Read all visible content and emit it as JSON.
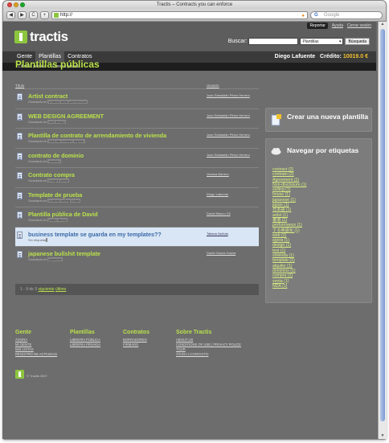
{
  "window": {
    "title": "Tractis – Contracts you can enforce"
  },
  "browser": {
    "url": "http://",
    "search_placeholder": "Google",
    "buttons": {
      "back": "◀",
      "forward": "▶",
      "reload": "C",
      "add": "+"
    }
  },
  "brand": {
    "name": "tractis",
    "accent": "#b9e14a",
    "logo_green": "#8cc63f"
  },
  "top_links": {
    "report": "Reportar",
    "help": "Ayuda",
    "logout": "Cerrar sesión"
  },
  "search": {
    "label": "Buscar:",
    "value": "",
    "scope": "Plantillas",
    "button": "Búsqueda"
  },
  "nav": {
    "tabs": [
      {
        "label": "Gente"
      },
      {
        "label": "Plantillas"
      },
      {
        "label": "Contratos"
      }
    ],
    "user": "Diego Lafuente",
    "credit_label": "Crédito:",
    "credit_value": "10019.0 €"
  },
  "subnav": {
    "items": [
      "Librería pública",
      "Librería privada"
    ]
  },
  "page_title": "Plantillas públicas",
  "table": {
    "headers": {
      "title": "Título",
      "user": "Usuario"
    },
    "rows": [
      {
        "title": "Artist contract",
        "meta_prefix": "Guardado en",
        "tags": "contract artist performance",
        "author": "Juan Sebastián Pérez Herrero"
      },
      {
        "title": "WEB DESIGN AGREEMENT",
        "meta_prefix": "Guardado en",
        "tags": "web design",
        "author": "Juan Sebastián Pérez Herrero"
      },
      {
        "title": "Plantilla de contrato de arrendamiento de vivienda",
        "meta_prefix": "Guardado en",
        "tags": "vivienda contrato alquiler",
        "author": "Juan Sebastián Pérez Herrero"
      },
      {
        "title": "contrato de dominio",
        "meta_prefix": "Guardado en",
        "tags": "dominio",
        "author": "Juan Sebastián Pérez Herrero"
      },
      {
        "title": "Contrato compra",
        "meta_prefix": "Guardado en",
        "tags": "compra venta",
        "author": "Vanesa Barrero"
      },
      {
        "title": "Template de prueba",
        "meta_prefix": "Guardado en",
        "tags": "contract selling house",
        "author": "Diego Lafuente"
      },
      {
        "title": "Plantilla pública de David",
        "meta_prefix": "Guardado en",
        "tags": "public library",
        "author": "David Blanco Gil"
      },
      {
        "title": "business template se guarda en my templates??",
        "meta_prefix": "Sin etiquetar",
        "tags": "",
        "author": "Tatiana Nuñola",
        "highlight": true
      },
      {
        "title": "japanese bullshit template",
        "meta_prefix": "Guardado en",
        "tags": "japanese",
        "author": "David García Garcia"
      }
    ]
  },
  "pager": {
    "prefix": "1 - 9 de 9",
    "next": "siguiente",
    "last": "último"
  },
  "sidebar": {
    "create_title": "Crear una nueva plantilla",
    "browse_title": "Navegar por etiquetas",
    "tags": [
      "contract (2)",
      "contrato (2)",
      "Agreement (1)",
      "Non-disclosure (1)",
      "selling (1)",
      "house (1)",
      "japanese (1)",
      "japan (1)",
      "日本語 (1)",
      "artist (1)",
      "書道 (1)",
      "performance (1)",
      "する英語化 (1)",
      "web (1)",
      "agora (1)",
      "design (1)",
      "test (1)",
      "vivienda (1)",
      "template (1)",
      "alquiler (1)",
      "dominios (1)",
      "compra (1)",
      "venta (1)",
      "NDA (1)"
    ]
  },
  "footer": {
    "columns": [
      {
        "title": "Gente",
        "links": [
          "ÁGORA",
          "MI GENTE",
          "MIS LISTAS",
          "REGISTRO DE ACTIVIDAD"
        ]
      },
      {
        "title": "Plantillas",
        "links": [
          "LIBRERÍA PÚBLICA",
          "LIBRERÍA PRIVADA"
        ]
      },
      {
        "title": "Contratos",
        "links": [
          "BORRADORES",
          "FIRMADO"
        ]
      },
      {
        "title": "Sobre Tractis",
        "links": [
          "ABOUT US",
          "CONDITIONS OF USE | PRIVACY POLICE",
          "TOUR",
          "AYUDA | CONTACTO"
        ]
      }
    ],
    "copyright": "© Tractis 2007"
  }
}
